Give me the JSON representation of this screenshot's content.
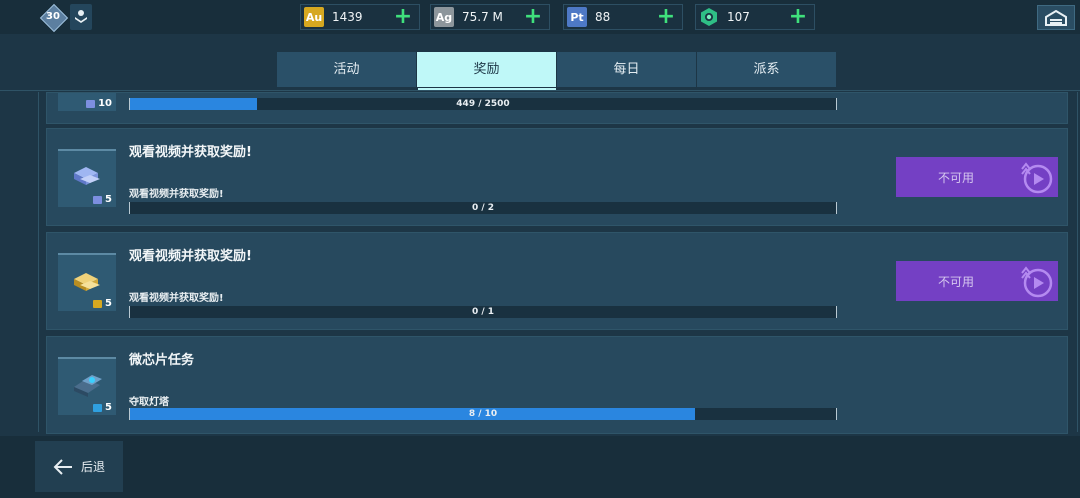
{
  "header": {
    "level": "30",
    "resources": [
      {
        "code": "Au",
        "value": "1439",
        "color": "#d6a820"
      },
      {
        "code": "Ag",
        "value": "75.7 M",
        "color": "#8d969c"
      },
      {
        "code": "Pt",
        "value": "88",
        "color": "#4e79c6"
      },
      {
        "code": "gem",
        "value": "107",
        "color": "#2fbf86"
      }
    ],
    "plus_symbol": "+"
  },
  "tabs": [
    {
      "label": "活动"
    },
    {
      "label": "奖励"
    },
    {
      "label": "每日"
    },
    {
      "label": "派系"
    }
  ],
  "active_tab": "奖励",
  "tasks": [
    {
      "title": "",
      "subtitle": "",
      "reward_count": "10",
      "progress_text": "449 / 2500",
      "progress": 0.1796
    },
    {
      "title": "观看视频并获取奖励!",
      "subtitle": "观看视频并获取奖励!",
      "reward_count": "5",
      "progress_text": "0 / 2",
      "progress": 0,
      "button_label": "不可用"
    },
    {
      "title": "观看视频并获取奖励!",
      "subtitle": "观看视频并获取奖励!",
      "reward_count": "5",
      "progress_text": "0 / 1",
      "progress": 0,
      "button_label": "不可用"
    },
    {
      "title": "微芯片任务",
      "subtitle": "夺取灯塔",
      "reward_count": "5",
      "progress_text": "8 / 10",
      "progress": 0.8
    }
  ],
  "footer": {
    "back_label": "后退"
  },
  "colors": {
    "accent_tab": "#bff8f8",
    "progress": "#2a86e0",
    "unavailable_button": "#7440c4"
  }
}
